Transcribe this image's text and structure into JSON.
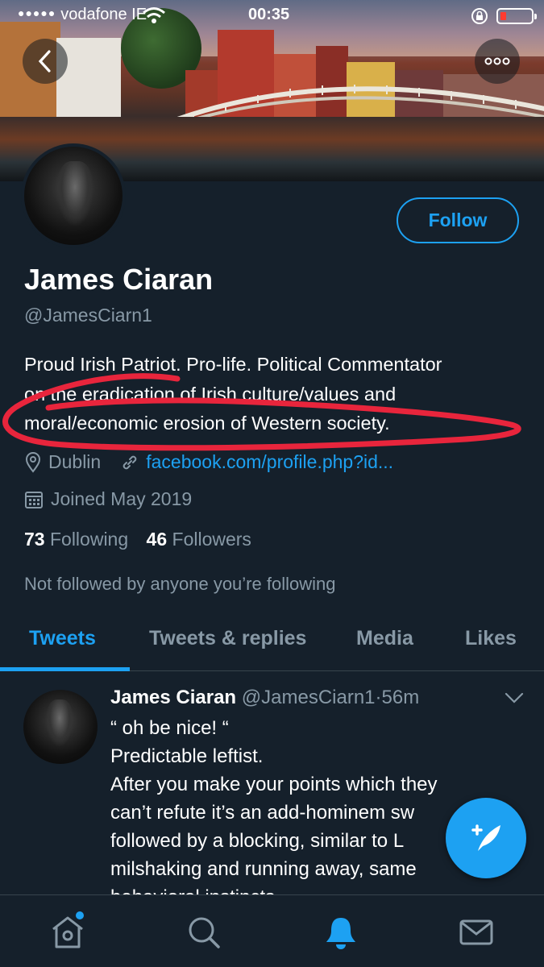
{
  "status_bar": {
    "carrier": "vodafone IE",
    "time": "00:35"
  },
  "profile": {
    "name": "James Ciaran",
    "handle": "@JamesCiarn1",
    "follow_label": "Follow",
    "bio_lines": [
      "Proud Irish Patriot. Pro-life. Political Commentator",
      "on the eradication of Irish culture/values and",
      "moral/economic erosion of Western society."
    ],
    "location": "Dublin",
    "website": "facebook.com/profile.php?id...",
    "joined": "Joined May 2019",
    "following_count": "73",
    "following_label": "Following",
    "followers_count": "46",
    "followers_label": "Followers",
    "not_followed": "Not followed by anyone you’re following"
  },
  "tabs": [
    {
      "label": "Tweets",
      "active": true
    },
    {
      "label": "Tweets & replies",
      "active": false
    },
    {
      "label": "Media",
      "active": false
    },
    {
      "label": "Likes",
      "active": false
    }
  ],
  "tweet": {
    "name": "James Ciaran",
    "handle": "@JamesCiarn1",
    "separator": "·",
    "time": "56m",
    "lines": [
      "“ oh be nice! “",
      "Predictable leftist.",
      "After you make your points which they",
      "can’t refute it’s an add-hominem sw",
      "followed by a blocking, similar to L",
      "milshaking and running away, same",
      "behavioral instincts"
    ]
  },
  "colors": {
    "background": "#15202b",
    "accent": "#1da1f2",
    "secondary_text": "#8899a6",
    "annotation_red": "#e8253c"
  },
  "icons": {
    "back": "chevron-left-icon",
    "more": "more-dots-icon",
    "location": "location-pin-icon",
    "link": "link-icon",
    "calendar": "calendar-icon",
    "compose": "compose-tweet-icon",
    "home": "home-icon",
    "search": "search-icon",
    "notifications": "bell-icon",
    "messages": "mail-icon"
  }
}
